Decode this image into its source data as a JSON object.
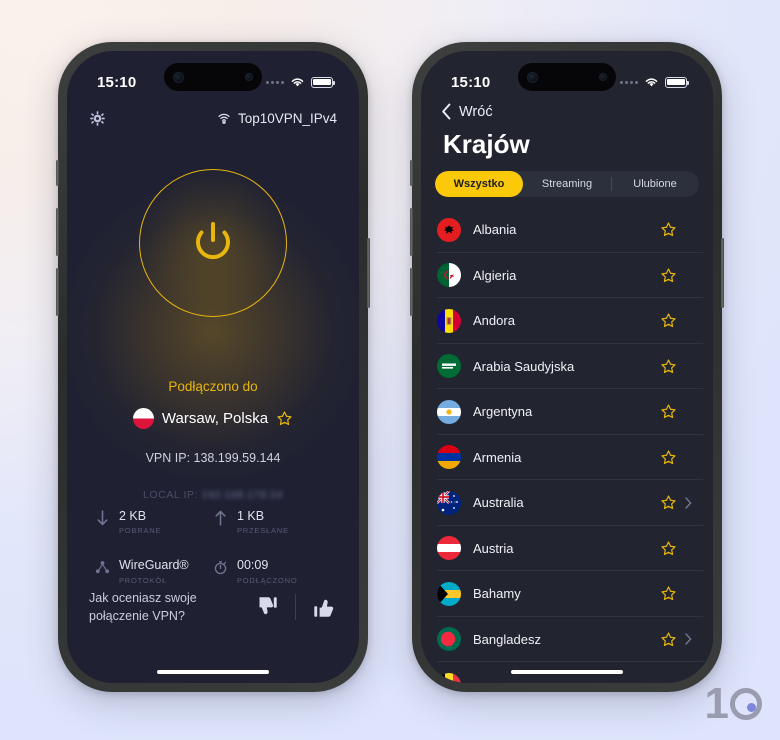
{
  "colors": {
    "accent_yellow": "#e8b60c",
    "tab_active": "#fcc90a",
    "screen_bg_left": "#1f2133",
    "screen_bg_right": "#22242f",
    "page_bg_start": "#fbf1ec",
    "page_bg_end": "#dde4fb"
  },
  "left_phone": {
    "status_bar": {
      "time": "15:10",
      "wifi_icon": "wifi-icon",
      "battery_icon": "battery-icon",
      "signal_icon": "signal-dots-icon"
    },
    "topbar": {
      "settings_icon": "gear-icon",
      "network_icon": "wifi-lock-icon",
      "network_name": "Top10VPN_IPv4"
    },
    "power_button": {
      "icon": "power-icon",
      "state": "connected"
    },
    "connection_status": "Podłączono do",
    "location": {
      "flag": "flag-poland",
      "name": "Warsaw, Polska",
      "star_icon": "star-outline-icon"
    },
    "vpn_ip": "VPN IP: 138.199.59.144",
    "local_ip_label": "LOCAL IP:",
    "local_ip_value": "192.168.178.24",
    "stats": [
      {
        "icon": "arrow-down-icon",
        "value": "2 KB",
        "label": "POBRANE"
      },
      {
        "icon": "arrow-up-icon",
        "value": "1 KB",
        "label": "PRZESŁANE"
      },
      {
        "icon": "protocol-node-icon",
        "value": "WireGuard®",
        "label": "PROTOKÓŁ"
      },
      {
        "icon": "stopwatch-icon",
        "value": "00:09",
        "label": "PODŁĄCZONO"
      }
    ],
    "rating": {
      "question_line1": "Jak oceniasz swoje",
      "question_line2": "połączenie VPN?",
      "thumbs_down_icon": "thumbs-down-icon",
      "thumbs_up_icon": "thumbs-up-icon"
    }
  },
  "right_phone": {
    "status_bar": {
      "time": "15:10",
      "wifi_icon": "wifi-icon",
      "battery_icon": "battery-icon",
      "signal_icon": "signal-dots-icon"
    },
    "back_label": "Wróć",
    "back_icon": "chevron-left-icon",
    "title": "Krajów",
    "tabs": [
      {
        "label": "Wszystko",
        "active": true
      },
      {
        "label": "Streaming",
        "active": false
      },
      {
        "label": "Ulubione",
        "active": false
      }
    ],
    "countries": [
      {
        "name": "Albania",
        "flag": "flag-albania",
        "star": "star-outline-icon",
        "chevron": false
      },
      {
        "name": "Algieria",
        "flag": "flag-algeria",
        "star": "star-outline-icon",
        "chevron": false
      },
      {
        "name": "Andora",
        "flag": "flag-andorra",
        "star": "star-outline-icon",
        "chevron": false
      },
      {
        "name": "Arabia Saudyjska",
        "flag": "flag-saudi-arabia",
        "star": "star-outline-icon",
        "chevron": false
      },
      {
        "name": "Argentyna",
        "flag": "flag-argentina",
        "star": "star-outline-icon",
        "chevron": false
      },
      {
        "name": "Armenia",
        "flag": "flag-armenia",
        "star": "star-outline-icon",
        "chevron": false
      },
      {
        "name": "Australia",
        "flag": "flag-australia",
        "star": "star-outline-icon",
        "chevron": true
      },
      {
        "name": "Austria",
        "flag": "flag-austria",
        "star": "star-outline-icon",
        "chevron": false
      },
      {
        "name": "Bahamy",
        "flag": "flag-bahamas",
        "star": "star-outline-icon",
        "chevron": false
      },
      {
        "name": "Bangladesz",
        "flag": "flag-bangladesh",
        "star": "star-outline-icon",
        "chevron": true
      },
      {
        "name": "",
        "flag": "flag-belgium",
        "star": "",
        "chevron": false
      }
    ]
  },
  "watermark": {
    "text": "1",
    "name": "top10vpn-logo"
  }
}
